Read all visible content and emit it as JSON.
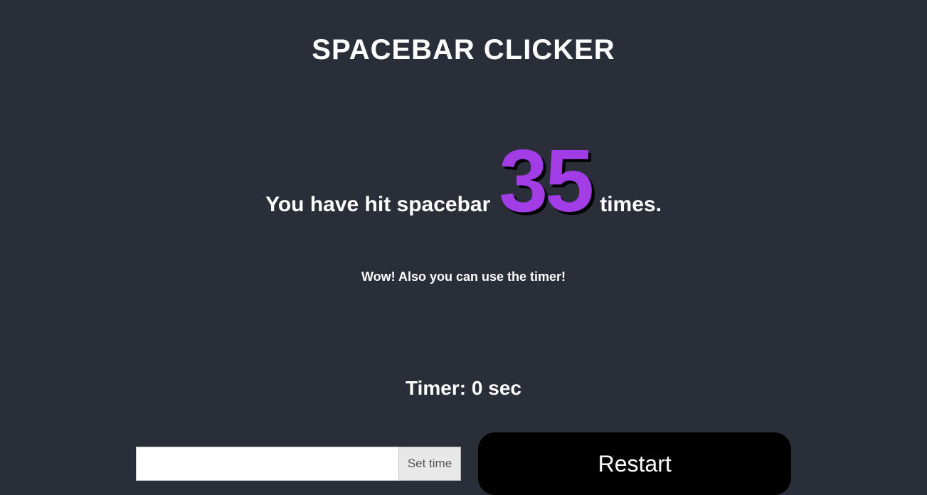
{
  "title": "SPACEBAR CLICKER",
  "counter": {
    "prefix": "You have hit spacebar",
    "value": "35",
    "suffix": "times."
  },
  "hint": "Wow! Also you can use the timer!",
  "timer": {
    "label": "Timer:",
    "value": "0",
    "unit": "sec"
  },
  "controls": {
    "time_input_value": "",
    "set_time_label": "Set time",
    "restart_label": "Restart"
  },
  "colors": {
    "background": "#2a2e38",
    "text": "#ffffff",
    "accent": "#a23ce6",
    "button": "#000000"
  }
}
